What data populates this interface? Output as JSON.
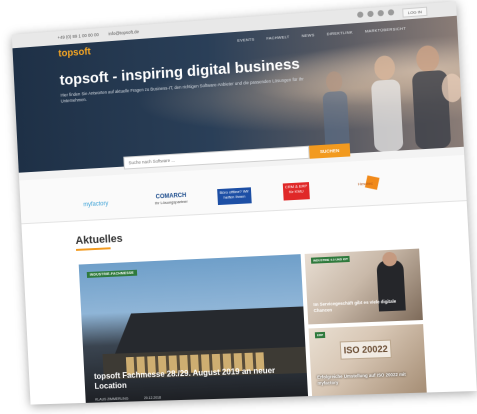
{
  "topbar": {
    "phone": "+49 (0) 89 1 00 00 00",
    "email": "info@topsoft.de",
    "login_label": "LOG IN"
  },
  "header": {
    "logo": "topsoft",
    "nav": [
      "EVENTS",
      "FACHWELT",
      "NEWS",
      "DIREKTLINK",
      "MARKTÜBERSICHT"
    ]
  },
  "hero": {
    "title": "topsoft - inspiring digital business",
    "subtitle": "Hier finden Sie Antworten auf aktuelle Fragen zu Business-IT, den richtigen Software-Anbieter und die passenden Lösungen für Ihr Unternehmen."
  },
  "search": {
    "placeholder": "Suche nach Software ...",
    "button_label": "SUCHEN"
  },
  "partners": [
    {
      "name": "myfactory"
    },
    {
      "name": "COMARCH",
      "sub": "Ihr Lösungspartner"
    },
    {
      "name": "Büro offline? Wir helfen Ihnen"
    },
    {
      "name": "CRM & ERP für KMU"
    },
    {
      "name": "Hesotec"
    }
  ],
  "news": {
    "section_title": "Aktuelles",
    "main": {
      "tag": "INDUSTRIE-FACHMESSE",
      "headline": "topsoft Fachmesse 28./29. August 2019 an neuer Location",
      "author": "KLAUS ZIMMERLING",
      "date": "20.12.2018"
    },
    "side": [
      {
        "tag": "INDUSTRIE 4.0 UND IOT",
        "headline": "Im Servicegeschäft gibt es viele digitale Chancen"
      },
      {
        "tag": "ERP",
        "headline": "Erfolgreiche Umstellung auf ISO 20022 mit myfactory",
        "badge": "ISO 20022"
      }
    ]
  },
  "colors": {
    "accent": "#f29a1f",
    "hero_dark": "#1e3046"
  }
}
